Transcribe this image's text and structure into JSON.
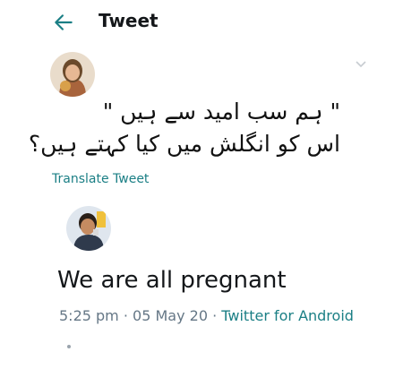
{
  "header": {
    "title": "Tweet",
    "back_icon": "arrow-left-icon",
    "accent": "#1b7f85"
  },
  "tweet": {
    "avatar_icon": "user-avatar-icon",
    "menu_icon": "chevron-down-icon",
    "text_line1": "\" ہم سب امید سے ہیں \"",
    "text_line2": "اس کو انگلش میں کیا کہتے ہیں؟",
    "translate_label": "Translate Tweet"
  },
  "reply": {
    "avatar_icon": "user-avatar-icon",
    "text": "We are all pregnant",
    "time": "5:25 pm",
    "date": "05 May 20",
    "source": "Twitter for Android",
    "separator": " · "
  }
}
